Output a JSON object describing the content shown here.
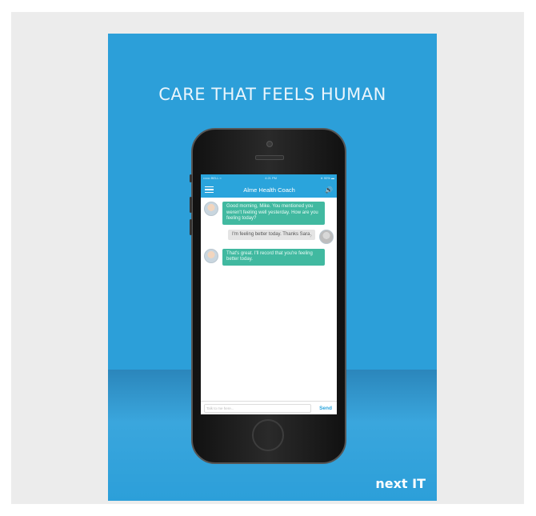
{
  "poster": {
    "headline": "CARE THAT FEELS HUMAN",
    "brand_next": "next",
    "brand_it": "IT"
  },
  "phone": {
    "status_carrier": "•••oo BELL ≈",
    "status_time": "4:21 PM",
    "status_battery": "∗ 90% ▬",
    "app_title": "Alme Health Coach",
    "input_placeholder": "Talk to me here...",
    "send_label": "Send",
    "messages": [
      {
        "from": "bot",
        "text": "Good morning, Mike. You mentioned you weren't feeling well yesterday. How are you feeling today?"
      },
      {
        "from": "user",
        "text": "I'm feeling better today. Thanks Sara."
      },
      {
        "from": "bot",
        "text": "That's great. I'll record that you're feeling better today."
      }
    ]
  },
  "colors": {
    "poster_bg": "#2c9fd9",
    "app_bar": "#2aa4dc",
    "bot_bubble": "#41b9a0"
  },
  "icons": [
    "menu-icon",
    "speaker-icon",
    "avatar"
  ]
}
